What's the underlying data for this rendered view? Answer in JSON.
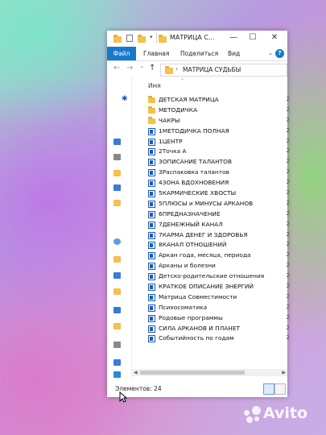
{
  "window": {
    "title": "МАТРИЦА С...",
    "controls": {
      "minimize": "—",
      "maximize": "☐",
      "close": "✕"
    }
  },
  "ribbon": {
    "tabs": [
      "Файл",
      "Главная",
      "Поделиться",
      "Вид"
    ],
    "help": "?"
  },
  "address": {
    "back": "←",
    "forward": "→",
    "recent": "⌄",
    "up": "↑",
    "separator": "›",
    "path": "МАТРИЦА СУДЬБЫ"
  },
  "column_header": {
    "name": "Имя"
  },
  "files": [
    {
      "name": "ДЕТСКАЯ МАТРИЦА",
      "type": "folder"
    },
    {
      "name": "МЕТОДИЧКА",
      "type": "folder"
    },
    {
      "name": "ЧАКРЫ",
      "type": "folder"
    },
    {
      "name": "1МЕТОДИЧКА ПОЛНАЯ",
      "type": "doc"
    },
    {
      "name": "1ЦЕНТР",
      "type": "doc"
    },
    {
      "name": "2Точка А",
      "type": "doc"
    },
    {
      "name": "3ОПИСАНИЕ ТАЛАНТОВ",
      "type": "doc"
    },
    {
      "name": "3Распаковка талантов",
      "type": "doc"
    },
    {
      "name": "4ЗОНА ВДОХНОВЕНИЯ",
      "type": "doc"
    },
    {
      "name": "5КАРМИЧЕСКИЕ ХВОСТЫ",
      "type": "doc"
    },
    {
      "name": "5ПЛЮСЫ и МИНУСЫ АРКАНОВ",
      "type": "doc"
    },
    {
      "name": "6ПРЕДНАЗНАЧЕНИЕ",
      "type": "doc"
    },
    {
      "name": "7ДЕНЕЖНЫЙ КАНАЛ",
      "type": "doc"
    },
    {
      "name": "7КАРМА ДЕНЕГ И ЗДОРОВЬЯ",
      "type": "doc"
    },
    {
      "name": "8КАНАЛ ОТНОШЕНИЙ",
      "type": "doc"
    },
    {
      "name": "Аркан года, месяца, периода",
      "type": "doc"
    },
    {
      "name": "Арканы и болезни",
      "type": "doc"
    },
    {
      "name": "Детско-родительские отношения",
      "type": "doc"
    },
    {
      "name": "КРАТКОЕ ОПИСАНИЕ ЭНЕРГИЙ",
      "type": "doc"
    },
    {
      "name": "Матрица Совместимости",
      "type": "doc"
    },
    {
      "name": "Психосоматика",
      "type": "doc"
    },
    {
      "name": "Родовые программы",
      "type": "doc"
    },
    {
      "name": "СИЛА АРКАНОВ И ПЛАНЕТ",
      "type": "doc"
    },
    {
      "name": "Событийность по годам",
      "type": "doc"
    }
  ],
  "size_col_char": "2",
  "status": {
    "items_count": "Элементов: 24"
  },
  "watermark": {
    "text": "Avito"
  },
  "colors": {
    "accent": "#1979ca",
    "folder": "#f2c14e",
    "doc": "#1a5bb8"
  }
}
